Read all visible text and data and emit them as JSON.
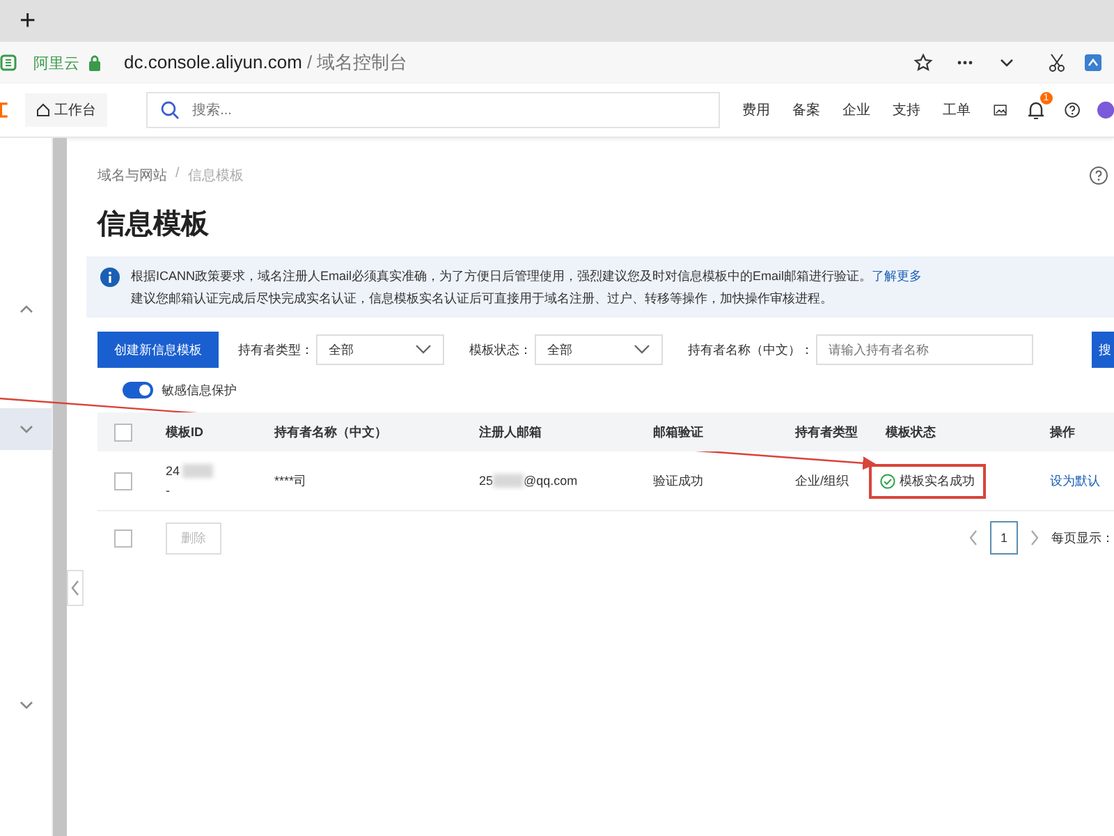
{
  "browser": {
    "new_tab": "+",
    "site_tag": "阿里云",
    "url_host": "dc.console.aliyun.com",
    "url_rest": " / 域名控制台"
  },
  "console_header": {
    "home": "工作台",
    "search": {
      "placeholder": "搜索..."
    },
    "nav": [
      "费用",
      "备案",
      "企业",
      "支持",
      "工单"
    ],
    "notification_count": "1"
  },
  "sidebar": {
    "items": [
      {
        "expanded": true,
        "selected": false
      },
      {
        "expanded": false,
        "selected": true
      },
      {
        "expanded": false,
        "selected": false
      }
    ]
  },
  "breadcrumb": [
    "域名与网站",
    "/",
    "信息模板"
  ],
  "title": "信息模板",
  "notice": {
    "text": "根据ICANN政策要求，域名注册人Email必须真实准确，为了方便日后管理使用，强烈建议您及时对信息模板中的Email邮箱进行验证。",
    "link": "了解更多",
    "text_2": "建议您邮箱认证完成后尽快完成实名认证，信息模板实名认证后可直接用于域名注册、过户、转移等操作，加快操作审核进程。"
  },
  "toolbar": {
    "create_button": "创建新信息模板",
    "filters": [
      {
        "label": "持有者类型：",
        "kind": "select",
        "value": "全部"
      },
      {
        "label": "模板状态：",
        "kind": "select",
        "value": "全部"
      },
      {
        "label": "持有者名称（中文）：",
        "kind": "input",
        "placeholder": "请输入持有者名称"
      }
    ],
    "search_button": "搜"
  },
  "privacy_toggle": {
    "label": "敏感信息保护",
    "on": true
  },
  "table": {
    "select_all_checked": false,
    "columns": [
      "模板ID",
      "持有者名称（中文）",
      "注册人邮箱",
      "邮箱验证",
      "持有者类型",
      "模板状态",
      "操作"
    ],
    "rows": [
      {
        "checked": false,
        "id_lines": [
          "24",
          "-"
        ],
        "holder": "****司",
        "email_parts": [
          "25",
          "@qq.com"
        ],
        "email_verify": "验证成功",
        "holder_type": "企业/组织",
        "status": "模板实名成功",
        "highlighted": true,
        "action": "设为默认"
      }
    ]
  },
  "footer": {
    "select_checked": false,
    "delete_button": "删除",
    "delete_disabled": true,
    "pages": [
      {
        "label": "1",
        "selected": true
      }
    ],
    "page_size_label": "每页显示："
  }
}
